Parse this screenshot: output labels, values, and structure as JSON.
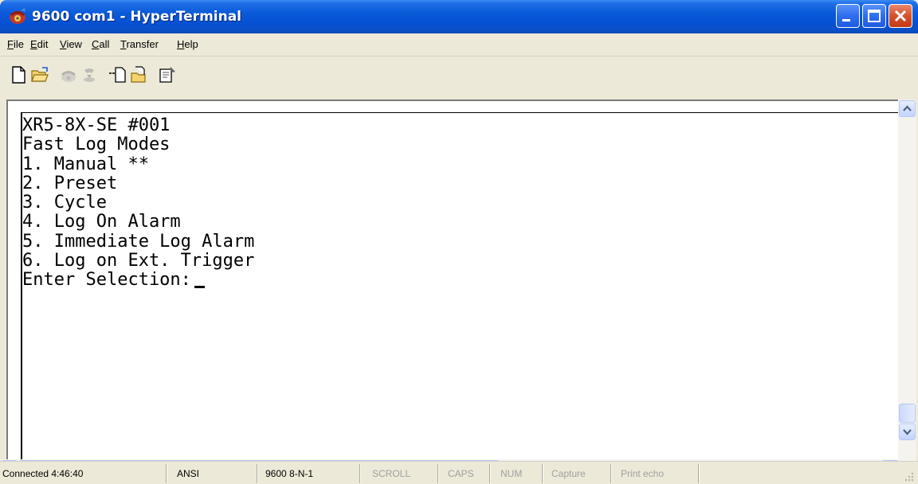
{
  "window": {
    "title": "9600 com1 - HyperTerminal",
    "icon": "hyperterminal-phone-icon",
    "controls": [
      "minimize-icon",
      "maximize-icon",
      "close-icon"
    ],
    "colors": {
      "titlebar": "#0a5ad8",
      "close": "#d6502c"
    }
  },
  "menu": {
    "file": {
      "first": "F",
      "rest": "ile"
    },
    "edit": {
      "first": "E",
      "rest": "dit"
    },
    "view": {
      "first": "V",
      "rest": "iew"
    },
    "call": {
      "first": "C",
      "rest": "all"
    },
    "transfer": {
      "first": "T",
      "rest": "ransfer"
    },
    "help": {
      "first": "H",
      "rest": "elp"
    }
  },
  "toolbar": [
    "new-connection-icon",
    "open-icon",
    "call-icon",
    "disconnect-icon",
    "send-icon",
    "receive-icon",
    "properties-icon"
  ],
  "terminal": {
    "lines": [
      "XR5-8X-SE #001",
      "Fast Log Modes",
      "1. Manual **",
      "2. Preset",
      "3. Cycle",
      "4. Log On Alarm",
      "5. Immediate Log Alarm",
      "6. Log on Ext. Trigger"
    ],
    "prompt": "Enter Selection:"
  },
  "status": {
    "connected": "Connected 4:46:40",
    "emulation": "ANSI",
    "settings": "9600 8-N-1",
    "scroll": "SCROLL",
    "caps": "CAPS",
    "num": "NUM",
    "capture": "Capture",
    "print_echo": "Print echo"
  }
}
